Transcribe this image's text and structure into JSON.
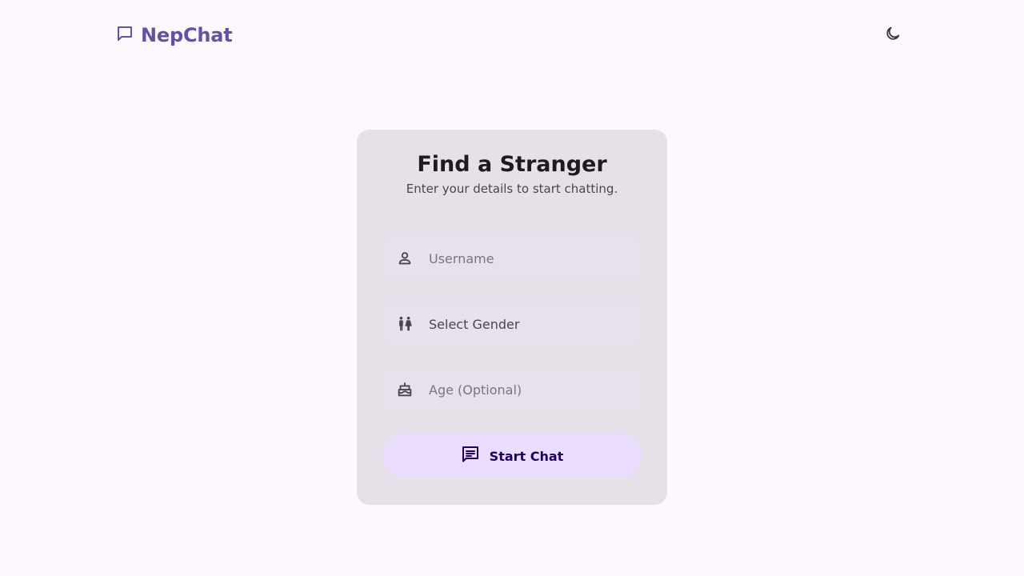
{
  "header": {
    "brand": "NepChat",
    "brand_icon": "chat-bubble-outline-icon",
    "theme_toggle_icon": "moon-icon"
  },
  "card": {
    "title": "Find a Stranger",
    "subtitle": "Enter your details to start chatting.",
    "fields": {
      "username": {
        "placeholder": "Username",
        "icon": "person-icon"
      },
      "gender": {
        "value": "Select Gender",
        "icon": "wc-icon"
      },
      "age": {
        "placeholder": "Age (Optional)",
        "icon": "cake-icon"
      }
    },
    "start_button": {
      "label": "Start Chat",
      "icon": "chat-icon"
    }
  },
  "colors": {
    "background": "#fdf8fd",
    "brand": "#6750a4",
    "card": "#e6e0e9",
    "button": "#eaddff",
    "button_text": "#21005d"
  }
}
